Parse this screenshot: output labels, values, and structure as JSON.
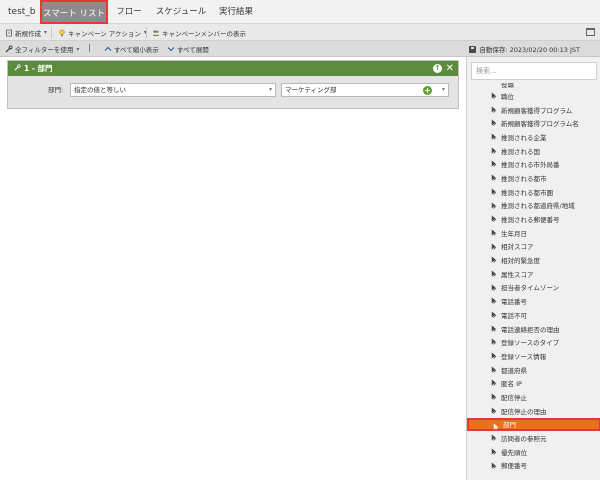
{
  "nav": {
    "title": "test_b",
    "tabs": [
      "スマート リスト",
      "フロー",
      "スケジュール",
      "実行結果"
    ],
    "active_tab": "スマート リスト"
  },
  "toolbar1": {
    "new_label": "新規作成",
    "campaign_action_label": "キャンペーン アクション",
    "show_members_label": "キャンペーンメンバーの表示"
  },
  "toolbar2": {
    "use_filter_label": "全フィルターを使用",
    "collapse_all_label": "すべて縮小表示",
    "expand_all_label": "すべて展開",
    "autosave_text": "自動保存: 2023/02/20 00:13 JST"
  },
  "filter": {
    "title": "1 - 部門",
    "field_label": "部門:",
    "operator_value": "指定の値と等しい",
    "value": "マーケティング部"
  },
  "sidebar": {
    "search_placeholder": "検索...",
    "partial_item": "役職",
    "items": [
      "職位",
      "新規顧客獲得プログラム",
      "新規顧客獲得プログラム名",
      "推測される企業",
      "推測される国",
      "推測される市外局番",
      "推測される都市",
      "推測される都市圏",
      "推測される都道府県/地域",
      "推測される郵便番号",
      "生年月日",
      "相対スコア",
      "相対的緊急度",
      "属性スコア",
      "担当者タイムゾーン",
      "電話番号",
      "電話不可",
      "電話連絡拒否の理由",
      "登録ソースのタイプ",
      "登録ソース情報",
      "都道府県",
      "匿名 IP",
      "配信停止",
      "配信停止の理由",
      "部門",
      "訪問者の参照元",
      "優先順位",
      "郵便番号"
    ],
    "selected_item": "部門"
  },
  "colors": {
    "filter_header": "#5b8c3e",
    "selected_item": "#e8721c",
    "highlight_border": "#e53935",
    "active_tab": "#8c8c8c"
  }
}
